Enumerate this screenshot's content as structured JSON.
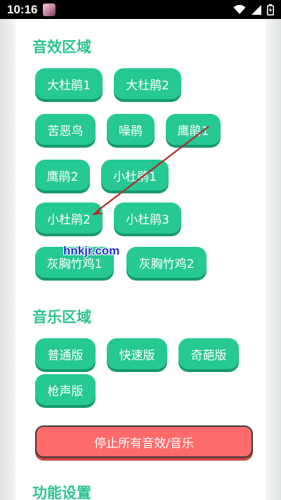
{
  "status_bar": {
    "time": "10:16",
    "icons": [
      "avatar-icon",
      "wifi-icon",
      "signal-icon",
      "battery-icon"
    ]
  },
  "sections": {
    "sound_effects": {
      "title": "音效区域",
      "buttons": [
        "大杜鹃1",
        "大杜鹃2",
        "苦恶鸟",
        "噪鹃",
        "鹰鹃1",
        "鹰鹃2",
        "小杜鹃1",
        "小杜鹃2",
        "小杜鹃3",
        "灰胸竹鸡1",
        "灰胸竹鸡2"
      ]
    },
    "music": {
      "title": "音乐区域",
      "buttons": [
        "普通版",
        "快速版",
        "奇葩版",
        "枪声版"
      ]
    },
    "stop_all_label": "停止所有音效/音乐",
    "settings": {
      "title": "功能设置"
    }
  },
  "watermark": "hnkjr.com",
  "colors": {
    "accent": "#26c894",
    "accent_shadow": "#159a6f",
    "title": "#2cc292",
    "stop_button": "#ff6b6b",
    "annotation_arrow": "#b02a2a",
    "watermark": "#2533c9"
  }
}
